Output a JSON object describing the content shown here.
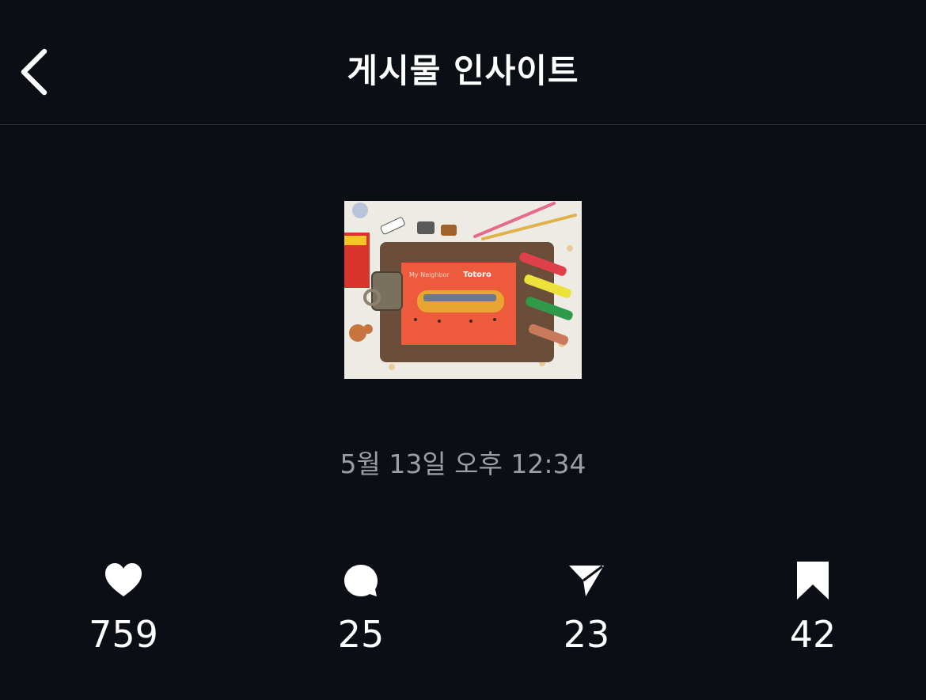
{
  "header": {
    "title": "게시물 인사이트",
    "back_icon": "chevron-left-icon"
  },
  "post": {
    "thumbnail": {
      "description_icon": "post-thumbnail-image",
      "card_text_line1": "My Neighbor",
      "card_text_line2": "Totoro"
    },
    "date": "5월 13일 오후 12:34"
  },
  "stats": [
    {
      "name": "likes",
      "icon": "heart-icon",
      "value": "759"
    },
    {
      "name": "comments",
      "icon": "comment-bubble-icon",
      "value": "25"
    },
    {
      "name": "shares",
      "icon": "send-paper-plane-icon",
      "value": "23"
    },
    {
      "name": "saves",
      "icon": "bookmark-icon",
      "value": "42"
    }
  ],
  "colors": {
    "background": "#0b0e15",
    "text": "#ffffff",
    "muted_text": "#9a9ea6",
    "divider": "#2a2d35"
  }
}
